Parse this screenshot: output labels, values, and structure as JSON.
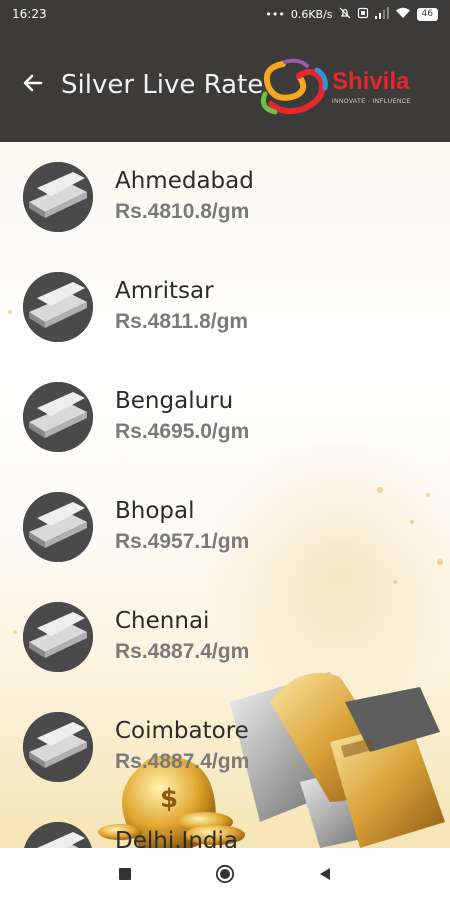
{
  "status_bar": {
    "time": "16:23",
    "network_speed": "0.6KB/s",
    "battery": "46"
  },
  "app_bar": {
    "title": "Silver Live Rate",
    "logo_name": "Shivila",
    "logo_tagline": "INNOVATE · INFLUENCE"
  },
  "rates": [
    {
      "city": "Ahmedabad",
      "rate": "Rs.4810.8/gm"
    },
    {
      "city": "Amritsar",
      "rate": "Rs.4811.8/gm"
    },
    {
      "city": "Bengaluru",
      "rate": "Rs.4695.0/gm"
    },
    {
      "city": "Bhopal",
      "rate": "Rs.4957.1/gm"
    },
    {
      "city": "Chennai",
      "rate": "Rs.4887.4/gm"
    },
    {
      "city": "Coimbatore",
      "rate": "Rs.4887.4/gm"
    },
    {
      "city": "Delhi.India",
      "rate": ""
    }
  ],
  "colors": {
    "app_bar": "#3c3b39",
    "logo_red": "#e8262d",
    "city_text": "#2b2b2b",
    "rate_text": "#7a7a7a"
  },
  "icons": {
    "back": "arrow-left-icon",
    "nav": [
      "square-icon",
      "circle-icon",
      "triangle-back-icon"
    ]
  }
}
